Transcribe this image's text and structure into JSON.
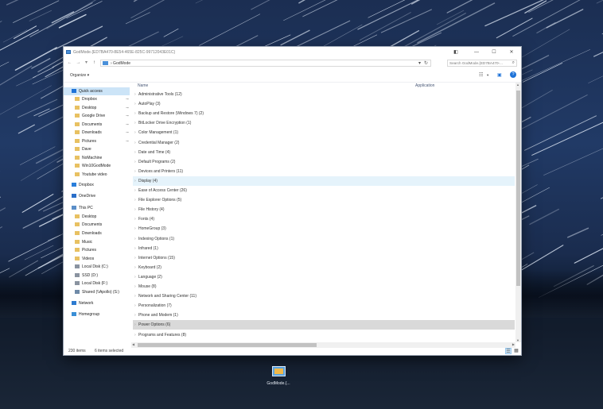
{
  "window": {
    "title": "GodMode.{ED7BA470-8E54-465E-825C-99712043E01C}",
    "minimize_glyph": "—",
    "maximize_glyph": "☐",
    "close_glyph": "✕",
    "pin_glyph": "◧"
  },
  "address": {
    "back_glyph": "←",
    "forward_glyph": "→",
    "recent_glyph": "▾",
    "up_glyph": "↑",
    "breadcrumb": "›  GodMode",
    "dropdown_glyph": "▾",
    "refresh_glyph": "↻",
    "search_placeholder": "Search GodMode.{ED7BA470-...",
    "search_glyph": "⌕"
  },
  "commandbar": {
    "organize_label": "Organize ▾",
    "view_glyph": "☷",
    "view_dropdown_glyph": "▾",
    "pane_glyph": "▣",
    "help_glyph": "?"
  },
  "nav": {
    "items": [
      {
        "label": "Quick access",
        "icon": "star-icon",
        "indent": 0,
        "pinned": false
      },
      {
        "label": "Dropbox",
        "icon": "folder-icon",
        "indent": 1,
        "pinned": true
      },
      {
        "label": "Desktop",
        "icon": "folder-icon",
        "indent": 1,
        "pinned": true
      },
      {
        "label": "Google Drive",
        "icon": "folder-icon",
        "indent": 1,
        "pinned": true
      },
      {
        "label": "Documents",
        "icon": "folder-icon",
        "indent": 1,
        "pinned": true
      },
      {
        "label": "Downloads",
        "icon": "folder-icon",
        "indent": 1,
        "pinned": true
      },
      {
        "label": "Pictures",
        "icon": "folder-icon",
        "indent": 1,
        "pinned": true
      },
      {
        "label": "Dave",
        "icon": "folder-icon",
        "indent": 1,
        "pinned": false
      },
      {
        "label": "NoMachine",
        "icon": "folder-icon",
        "indent": 1,
        "pinned": false
      },
      {
        "label": "Win10GodMode",
        "icon": "folder-icon",
        "indent": 1,
        "pinned": false
      },
      {
        "label": "Youtube video",
        "icon": "folder-icon",
        "indent": 1,
        "pinned": false
      },
      {
        "label": "Dropbox",
        "icon": "dropbox-icon",
        "indent": 0,
        "pinned": false
      },
      {
        "label": "OneDrive",
        "icon": "cloud-icon",
        "indent": 0,
        "pinned": false
      },
      {
        "label": "This PC",
        "icon": "computer-icon",
        "indent": 0,
        "pinned": false
      },
      {
        "label": "Desktop",
        "icon": "folder-icon",
        "indent": 1,
        "pinned": false
      },
      {
        "label": "Documents",
        "icon": "folder-icon",
        "indent": 1,
        "pinned": false
      },
      {
        "label": "Downloads",
        "icon": "folder-icon",
        "indent": 1,
        "pinned": false
      },
      {
        "label": "Music",
        "icon": "folder-icon",
        "indent": 1,
        "pinned": false
      },
      {
        "label": "Pictures",
        "icon": "folder-icon",
        "indent": 1,
        "pinned": false
      },
      {
        "label": "Videos",
        "icon": "folder-icon",
        "indent": 1,
        "pinned": false
      },
      {
        "label": "Local Disk (C:)",
        "icon": "drive-icon",
        "indent": 1,
        "pinned": false
      },
      {
        "label": "SSD (D:)",
        "icon": "drive-icon",
        "indent": 1,
        "pinned": false
      },
      {
        "label": "Local Disk (F:)",
        "icon": "drive-icon",
        "indent": 1,
        "pinned": false
      },
      {
        "label": "Shared (\\\\Apollo) (S:)",
        "icon": "network-drive-icon",
        "indent": 1,
        "pinned": false
      },
      {
        "label": "Network",
        "icon": "network-icon",
        "indent": 0,
        "pinned": false
      },
      {
        "label": "Homegroup",
        "icon": "homegroup-icon",
        "indent": 0,
        "pinned": false
      }
    ],
    "pin_glyph": "📌"
  },
  "columns": {
    "name": "Name",
    "application": "Application"
  },
  "groups": [
    {
      "label": "Administrative Tools (12)",
      "state": "normal"
    },
    {
      "label": "AutoPlay (3)",
      "state": "normal"
    },
    {
      "label": "Backup and Restore (Windows 7) (2)",
      "state": "normal"
    },
    {
      "label": "BitLocker Drive Encryption (1)",
      "state": "normal"
    },
    {
      "label": "Color Management (1)",
      "state": "normal"
    },
    {
      "label": "Credential Manager (2)",
      "state": "normal"
    },
    {
      "label": "Date and Time (4)",
      "state": "normal"
    },
    {
      "label": "Default Programs (2)",
      "state": "normal"
    },
    {
      "label": "Devices and Printers (11)",
      "state": "normal"
    },
    {
      "label": "Display (4)",
      "state": "hover"
    },
    {
      "label": "Ease of Access Center (26)",
      "state": "normal"
    },
    {
      "label": "File Explorer Options (5)",
      "state": "normal"
    },
    {
      "label": "File History (4)",
      "state": "normal"
    },
    {
      "label": "Fonts (4)",
      "state": "normal"
    },
    {
      "label": "HomeGroup (3)",
      "state": "normal"
    },
    {
      "label": "Indexing Options (1)",
      "state": "normal"
    },
    {
      "label": "Infrared (1)",
      "state": "normal"
    },
    {
      "label": "Internet Options (15)",
      "state": "normal"
    },
    {
      "label": "Keyboard (2)",
      "state": "normal"
    },
    {
      "label": "Language (2)",
      "state": "normal"
    },
    {
      "label": "Mouse (8)",
      "state": "normal"
    },
    {
      "label": "Network and Sharing Center (11)",
      "state": "normal"
    },
    {
      "label": "Personalization (7)",
      "state": "normal"
    },
    {
      "label": "Phone and Modem (1)",
      "state": "normal"
    },
    {
      "label": "Power Options (6)",
      "state": "selected"
    },
    {
      "label": "Programs and Features (8)",
      "state": "normal"
    }
  ],
  "status": {
    "count": "230 items",
    "selection": "6 items selected",
    "details_view_glyph": "☰",
    "tiles_view_glyph": "▦"
  },
  "desktop_icon": {
    "label": "GodMode.{..."
  }
}
